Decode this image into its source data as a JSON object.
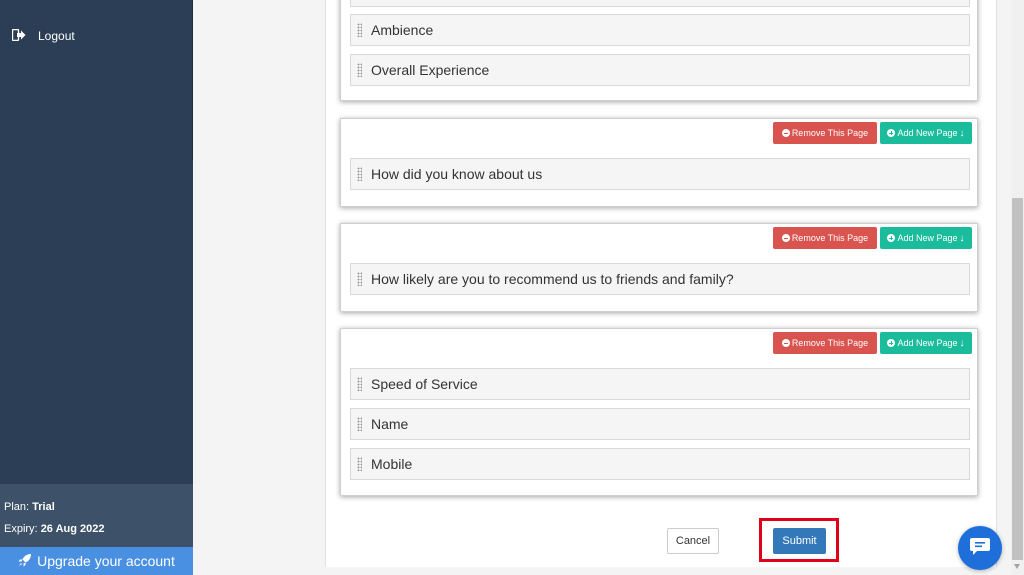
{
  "sidebar": {
    "logout_label": "Logout",
    "plan_label": "Plan:",
    "plan_value": "Trial",
    "expiry_label": "Expiry:",
    "expiry_value": "26 Aug 2022",
    "upgrade_label": "Upgrade your account"
  },
  "pages": [
    {
      "questions": [
        "Ambience",
        "Overall Experience"
      ]
    },
    {
      "remove_label": "Remove This Page",
      "add_label": "Add New Page",
      "questions": [
        "How did you know about us"
      ]
    },
    {
      "remove_label": "Remove This Page",
      "add_label": "Add New Page",
      "questions": [
        "How likely are you to recommend us to friends and family?"
      ]
    },
    {
      "remove_label": "Remove This Page",
      "add_label": "Add New Page",
      "questions": [
        "Speed of Service",
        "Name",
        "Mobile"
      ]
    }
  ],
  "actions": {
    "cancel_label": "Cancel",
    "submit_label": "Submit"
  },
  "colors": {
    "sidebar_bg": "#2b3e56",
    "remove_btn": "#d9534f",
    "add_btn": "#1abc9c",
    "submit_btn": "#3378b8",
    "highlight": "#e0001a",
    "chat": "#1e6fd9"
  },
  "icons": {
    "logout": "sign-out-icon",
    "upgrade": "rocket-icon",
    "remove": "minus-circle-icon",
    "add": "plus-circle-icon",
    "chat": "chat-icon"
  }
}
